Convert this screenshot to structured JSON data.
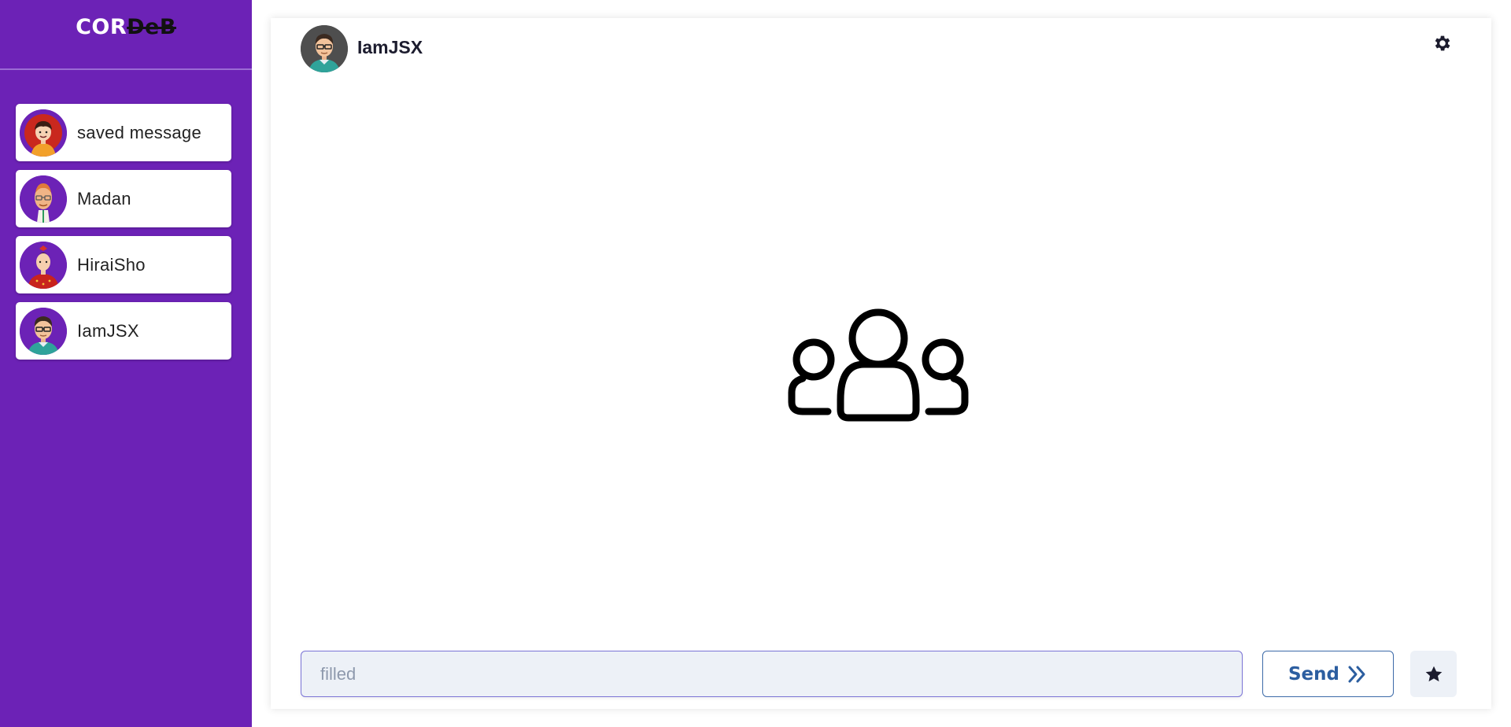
{
  "brand": {
    "part_a": "COR",
    "part_b": "DeB"
  },
  "sidebar": {
    "items": [
      {
        "label": "saved message",
        "avatar": "avatar-red-hair"
      },
      {
        "label": "Madan",
        "avatar": "avatar-bald-glasses"
      },
      {
        "label": "HiraiSho",
        "avatar": "avatar-red-uniform"
      },
      {
        "label": "IamJSX",
        "avatar": "avatar-glasses"
      }
    ]
  },
  "header": {
    "username": "IamJSX",
    "settings_icon": "gear-icon"
  },
  "main": {
    "illustration": "group-users-icon"
  },
  "composer": {
    "input_value": "",
    "placeholder": "filled",
    "send_label": "Send",
    "send_icon": "double-chevron-right-icon",
    "star_icon": "star-icon"
  },
  "colors": {
    "sidebar": "#6c22b6",
    "accent": "#2c5ea0",
    "input_border": "#7b74d6",
    "input_bg": "#edf1f7"
  }
}
